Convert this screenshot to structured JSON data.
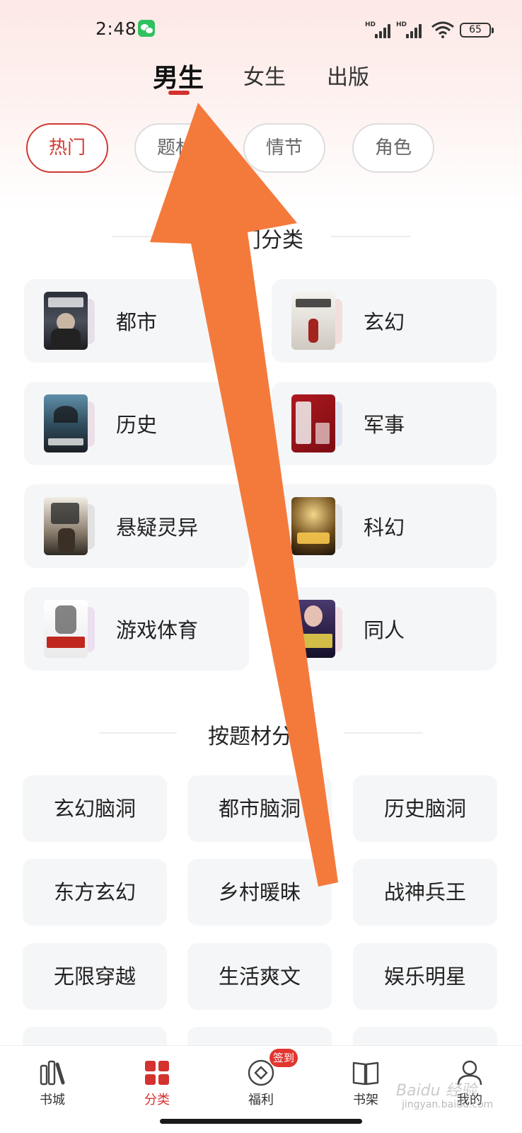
{
  "status_bar": {
    "time": "2:48",
    "battery": "65",
    "signal_label": "HD"
  },
  "gender_tabs": [
    {
      "label": "男生",
      "active": true
    },
    {
      "label": "女生",
      "active": false
    },
    {
      "label": "出版",
      "active": false
    }
  ],
  "filter_chips": [
    {
      "label": "热门",
      "active": true
    },
    {
      "label": "题材",
      "active": false
    },
    {
      "label": "情节",
      "active": false
    },
    {
      "label": "角色",
      "active": false
    }
  ],
  "hot_section": {
    "title": "热门分类",
    "categories": [
      {
        "label": "都市",
        "cover": "cover-dushi"
      },
      {
        "label": "玄幻",
        "cover": "cover-xuanhuan"
      },
      {
        "label": "历史",
        "cover": "cover-lishi"
      },
      {
        "label": "军事",
        "cover": "cover-junshi"
      },
      {
        "label": "悬疑灵异",
        "cover": "cover-xuanyi"
      },
      {
        "label": "科幻",
        "cover": "cover-kehuan"
      },
      {
        "label": "游戏体育",
        "cover": "cover-youxi"
      },
      {
        "label": "同人",
        "cover": "cover-tongren"
      }
    ]
  },
  "topic_section": {
    "title": "按题材分类",
    "topics": [
      "玄幻脑洞",
      "都市脑洞",
      "历史脑洞",
      "东方玄幻",
      "乡村暖昧",
      "战神兵王",
      "无限穿越",
      "生活爽文",
      "娱乐明星"
    ]
  },
  "bottom_nav": [
    {
      "label": "书城",
      "icon": "bookstore-icon",
      "active": false
    },
    {
      "label": "分类",
      "icon": "category-grid-icon",
      "active": true
    },
    {
      "label": "福利",
      "icon": "coin-icon",
      "active": false,
      "badge": "签到"
    },
    {
      "label": "书架",
      "icon": "bookshelf-icon",
      "active": false
    },
    {
      "label": "我的",
      "icon": "profile-icon",
      "active": false
    }
  ],
  "watermark": {
    "brand": "Baidu 经验",
    "url": "jingyan.baidu.com"
  },
  "colors": {
    "accent": "#d2312f",
    "card_bg": "#f5f6f8",
    "annotation_arrow": "#f47a3c"
  }
}
